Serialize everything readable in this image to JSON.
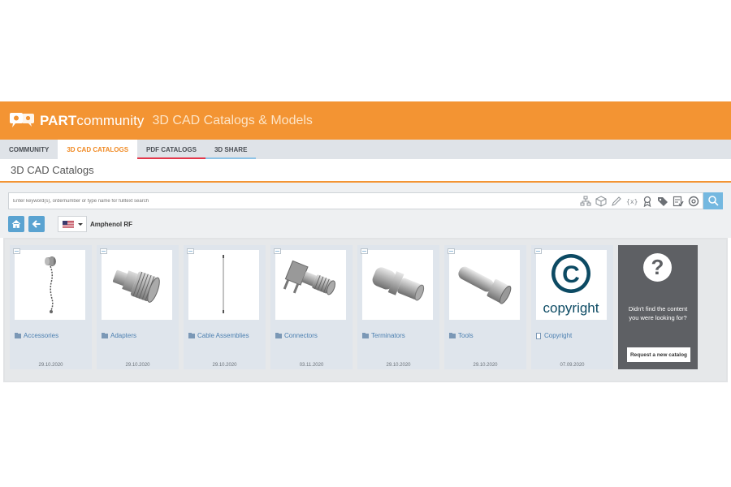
{
  "header": {
    "logo_bold": "PART",
    "logo_light": "community",
    "title": "3D CAD Catalogs & Models"
  },
  "tabs": [
    {
      "label": "COMMUNITY"
    },
    {
      "label": "3D CAD CATALOGS"
    },
    {
      "label": "PDF CATALOGS"
    },
    {
      "label": "3D SHARE"
    }
  ],
  "page": {
    "title": "3D CAD Catalogs"
  },
  "search": {
    "placeholder": "Enter keyword(s), ordernumber or type name for fulltext search"
  },
  "breadcrumb": {
    "brand": "Amphenol RF"
  },
  "catalogs": [
    {
      "label": "Accessories",
      "date": "29.10.2020"
    },
    {
      "label": "Adapters",
      "date": "29.10.2020"
    },
    {
      "label": "Cable Assemblies",
      "date": "29.10.2020"
    },
    {
      "label": "Connectors",
      "date": "03.11.2020"
    },
    {
      "label": "Terminators",
      "date": "29.10.2020"
    },
    {
      "label": "Tools",
      "date": "29.10.2020"
    },
    {
      "label": "Copyright",
      "date": "07.09.2020",
      "image_text": "copyright"
    }
  ],
  "help_card": {
    "text": "Didn't find the content you were looking for?",
    "button": "Request a new catalog"
  },
  "colors": {
    "header_orange": "#f39433",
    "accent_blue": "#5aa3d1",
    "link_blue": "#4b7fb0"
  }
}
